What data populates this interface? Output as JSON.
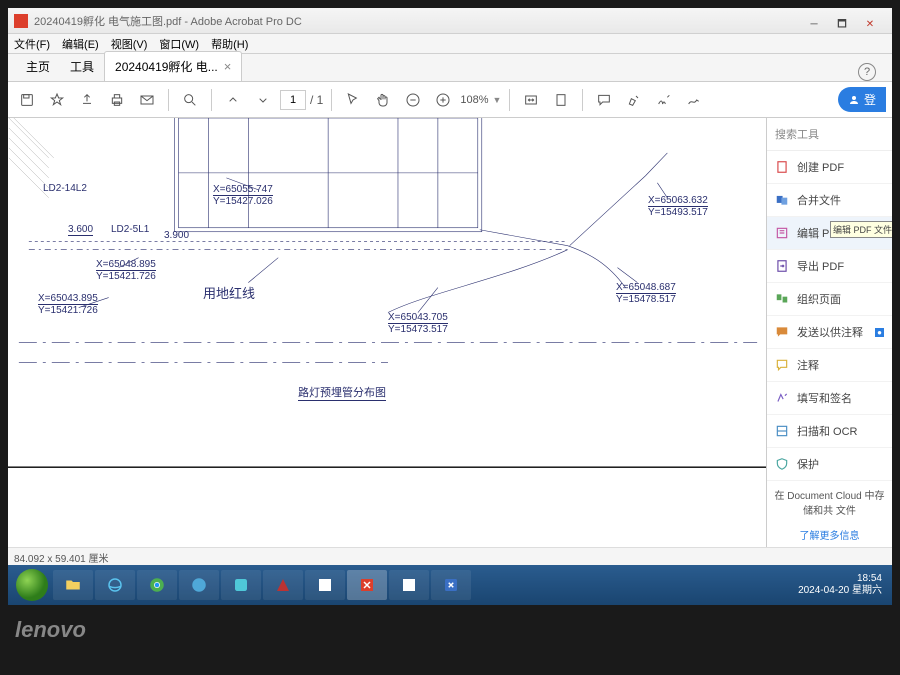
{
  "laptop": {
    "brand": "lenovo"
  },
  "window": {
    "title": "20240419孵化 电气施工图.pdf - Adobe Acrobat Pro DC"
  },
  "menu": {
    "file": "文件(F)",
    "edit": "编辑(E)",
    "view": "视图(V)",
    "window": "窗口(W)",
    "help": "帮助(H)"
  },
  "tabs": {
    "home": "主页",
    "tools": "工具",
    "doc": "20240419孵化 电...",
    "close": "×"
  },
  "toolbar": {
    "page_current": "1",
    "page_sep": "/ 1",
    "zoom": "108%",
    "signin": "登"
  },
  "drawing": {
    "ld2_14l2": "LD2-14L2",
    "dim_3600": "3.600",
    "ld2_5l1": "LD2-5L1",
    "dim_3900": "3.900",
    "coord1_x": "X=65055.747",
    "coord1_y": "Y=15427.026",
    "coord2_x": "X=65048.895",
    "coord2_y": "Y=15421.726",
    "coord3_x": "X=65043.895",
    "coord3_y": "Y=15421.726",
    "coord4_x": "X=65043.705",
    "coord4_y": "Y=15473.517",
    "coord5_x": "X=65048.687",
    "coord5_y": "Y=15478.517",
    "coord6_x": "X=65063.632",
    "coord6_y": "Y=15493.517",
    "redline": "用地红线",
    "title": "路灯预埋管分布图"
  },
  "sidepanel": {
    "search": "搜索工具",
    "create": "创建 PDF",
    "combine": "合并文件",
    "edit": "编辑 PDF",
    "edit_tooltip": "编辑 PDF 文件中的文",
    "export": "导出 PDF",
    "organize": "组织页面",
    "send": "发送以供注释",
    "comment": "注释",
    "fillsign": "填写和签名",
    "scanocr": "扫描和 OCR",
    "protect": "保护",
    "footer": "在 Document Cloud 中存储和共\n文件",
    "more": "了解更多信息"
  },
  "status": {
    "dimensions": "84.092 x 59.401 厘米"
  },
  "tray": {
    "time": "18:54",
    "date": "2024-04-20 星期六"
  }
}
